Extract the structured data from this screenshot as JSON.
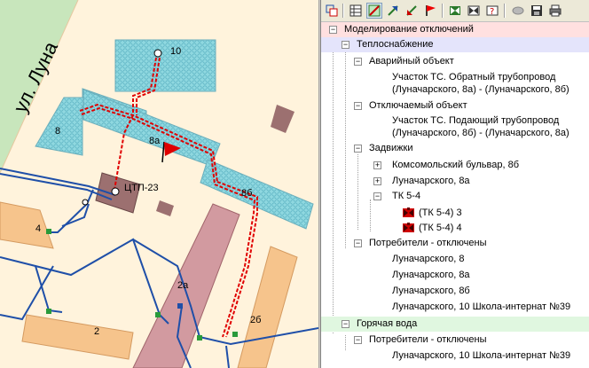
{
  "map": {
    "street_label": "ул. Луна",
    "building_labels": {
      "b10": "10",
      "b8": "8",
      "b8a": "8а",
      "b8b": "8б",
      "ctp": "ЦТП-23",
      "b4": "4",
      "b2": "2",
      "b2a": "2а",
      "b2b": "2б"
    },
    "colors": {
      "background": "#fff3dc",
      "street": "#c8e6bc",
      "building_blue": "#8fd8e0",
      "building_orange": "#f6c48c",
      "building_pink": "#d29aa0",
      "pipe_red": "#e00000",
      "pipe_blue": "#1f4fa8"
    }
  },
  "toolbar": {
    "icons": [
      "refresh-icon",
      "table-icon",
      "network-active-icon",
      "undo-flag-icon",
      "redo-flag-icon",
      "red-flag-icon",
      "valve-green-icon",
      "valve-red-icon",
      "help-icon",
      "disk-gray-icon",
      "save-icon",
      "print-icon"
    ]
  },
  "tree": {
    "root": "Моделирование отключений",
    "heat": "Теплоснабжение",
    "emergency": "Аварийный объект",
    "emergency_item_line1": "Участок ТС. Обратный трубопровод",
    "emergency_item_line2": "(Луначарского, 8а) - (Луначарского, 8б)",
    "disconnected": "Отключаемый объект",
    "disconnected_item_line1": "Участок ТС. Подающий трубопровод",
    "disconnected_item_line2": "(Луначарского, 8б) - (Луначарского, 8а)",
    "valves": "Задвижки",
    "valve1": "Комсомольский бульвар, 8б",
    "valve2": "Луначарского, 8а",
    "valve3": "ТК 5-4",
    "valve3_sub1": "(ТК 5-4) 3",
    "valve3_sub2": "(ТК 5-4) 4",
    "consumers": "Потребители - отключены",
    "consumer1": "Луначарского, 8",
    "consumer2": "Луначарского, 8а",
    "consumer3": "Луначарского, 8б",
    "consumer4": "Луначарского, 10 Школа-интернат №39",
    "hotwater": "Горячая вода",
    "hw_consumers": "Потребители - отключены",
    "hw_consumer1": "Луначарского, 10 Школа-интернат №39"
  }
}
